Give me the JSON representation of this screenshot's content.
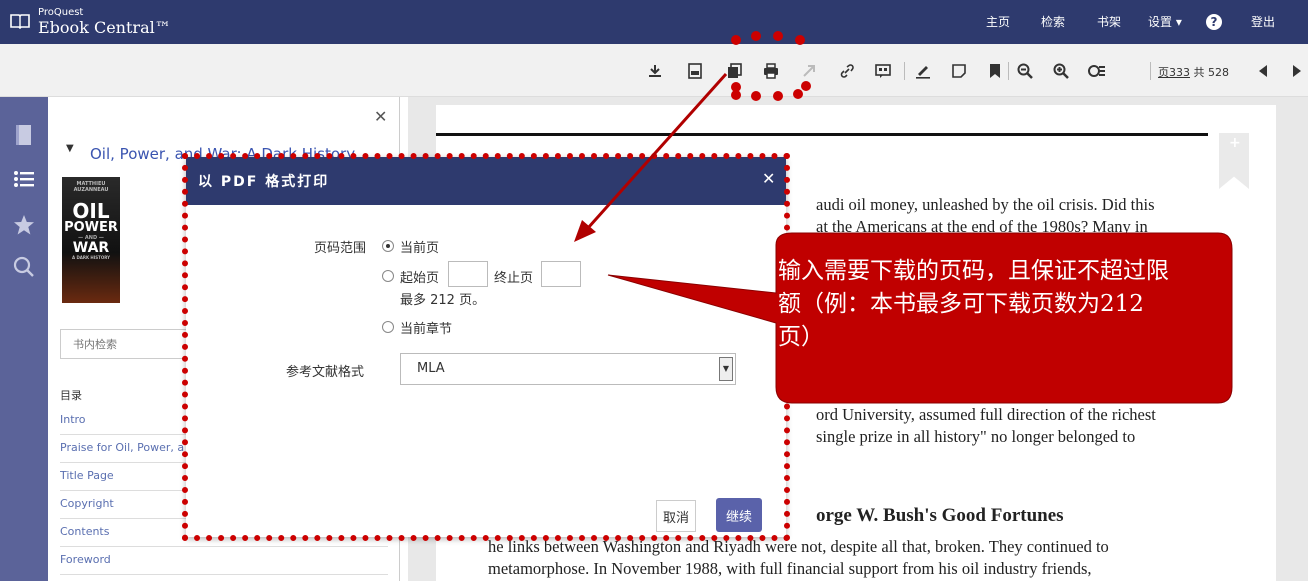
{
  "brand": {
    "top": "ProQuest",
    "main": "Ebook Central™"
  },
  "nav": {
    "home": "主页",
    "search": "检索",
    "bookshelf": "书架",
    "settings": "设置 ▾",
    "help": "?",
    "logout": "登出"
  },
  "toolbar": {
    "page_label": "页",
    "page_number": "333",
    "page_total_label": "共 528"
  },
  "left_panel": {
    "book_title": "Oil, Power, and War: A Dark History",
    "cover": {
      "line1": "MATTHIEU AUZANNEAU",
      "line2": "OIL",
      "line3": "POWER",
      "line4": "— AND —",
      "line5": "WAR",
      "line6": "A DARK HISTORY"
    },
    "search_placeholder": "书内检索",
    "toc_heading": "目录",
    "toc_items": [
      "Intro",
      "Praise for Oil, Power, a",
      "Title Page",
      "Copyright",
      "Contents",
      "Foreword"
    ]
  },
  "modal": {
    "title": "以 PDF 格式打印",
    "range_label": "页码范围",
    "option_current_page": "当前页",
    "option_start_page": "起始页",
    "option_end_page": "终止页",
    "max_pages_note": "最多 212 页。",
    "option_current_chapter": "当前章节",
    "citation_label": "参考文献格式",
    "citation_value": "MLA",
    "cancel": "取消",
    "continue": "继续"
  },
  "page_text": {
    "l1": "audi oil money, unleashed by the oil crisis. Did this",
    "l2": "at the Americans at the end of the 1980s? Many in",
    "l3": "ord University, assumed full direction of the richest",
    "l4": "single prize in all history\" no longer belonged to",
    "heading": "orge W. Bush's Good Fortunes",
    "l5": "he links between Washington and Riyadh were not, despite all that, broken. They continued to",
    "l6": "metamorphose. In November 1988, with full financial support from his oil industry friends,"
  },
  "annotation": {
    "callout": "输入需要下载的页码，且保证不超过限额（例：本书最多可下载页数为212页）"
  },
  "colors": {
    "navbar": "#2e3a6e",
    "rail": "#5b6399",
    "accent": "#5a62aa",
    "annotation_red": "#cc0000"
  }
}
